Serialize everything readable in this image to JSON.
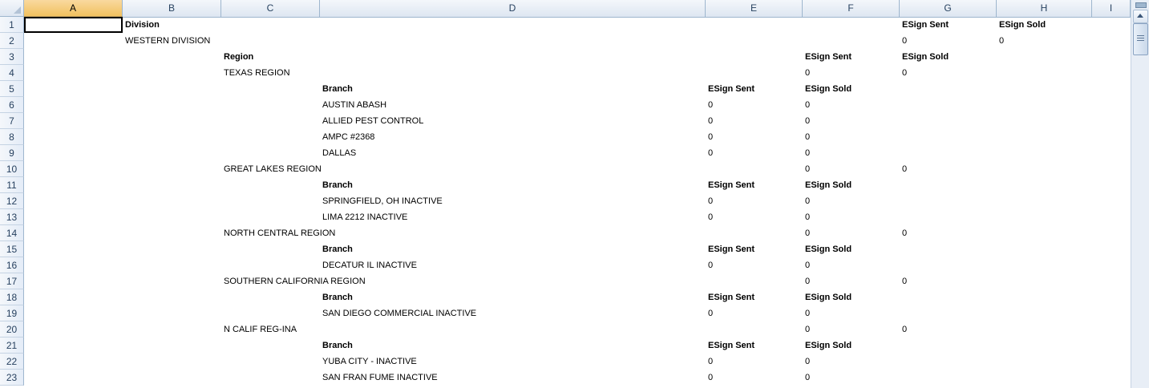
{
  "columns": [
    "A",
    "B",
    "C",
    "D",
    "E",
    "F",
    "G",
    "H",
    "I"
  ],
  "selected_column": "A",
  "rows": [
    {
      "n": "1",
      "cells": [
        {
          "col": "B",
          "text": "Division",
          "bold": true
        },
        {
          "col": "G",
          "text": "ESign Sent",
          "bold": true
        },
        {
          "col": "H",
          "text": "ESign Sold",
          "bold": true
        }
      ]
    },
    {
      "n": "2",
      "cells": [
        {
          "col": "B",
          "text": "WESTERN DIVISION"
        },
        {
          "col": "G",
          "text": "0"
        },
        {
          "col": "H",
          "text": "0"
        }
      ]
    },
    {
      "n": "3",
      "cells": [
        {
          "col": "C",
          "text": "Region",
          "bold": true
        },
        {
          "col": "F",
          "text": "ESign Sent",
          "bold": true
        },
        {
          "col": "G",
          "text": "ESign Sold",
          "bold": true
        }
      ]
    },
    {
      "n": "4",
      "cells": [
        {
          "col": "C",
          "text": "TEXAS REGION"
        },
        {
          "col": "F",
          "text": "0"
        },
        {
          "col": "G",
          "text": "0"
        }
      ]
    },
    {
      "n": "5",
      "cells": [
        {
          "col": "D",
          "text": "Branch",
          "bold": true
        },
        {
          "col": "E",
          "text": "ESign Sent",
          "bold": true
        },
        {
          "col": "F",
          "text": "ESign Sold",
          "bold": true
        }
      ]
    },
    {
      "n": "6",
      "cells": [
        {
          "col": "D",
          "text": "AUSTIN ABASH"
        },
        {
          "col": "E",
          "text": "0"
        },
        {
          "col": "F",
          "text": "0"
        }
      ]
    },
    {
      "n": "7",
      "cells": [
        {
          "col": "D",
          "text": "ALLIED PEST CONTROL"
        },
        {
          "col": "E",
          "text": "0"
        },
        {
          "col": "F",
          "text": "0"
        }
      ]
    },
    {
      "n": "8",
      "cells": [
        {
          "col": "D",
          "text": "AMPC #2368"
        },
        {
          "col": "E",
          "text": "0"
        },
        {
          "col": "F",
          "text": "0"
        }
      ]
    },
    {
      "n": "9",
      "cells": [
        {
          "col": "D",
          "text": "DALLAS"
        },
        {
          "col": "E",
          "text": "0"
        },
        {
          "col": "F",
          "text": "0"
        }
      ]
    },
    {
      "n": "10",
      "cells": [
        {
          "col": "C",
          "text": "GREAT LAKES REGION"
        },
        {
          "col": "F",
          "text": "0"
        },
        {
          "col": "G",
          "text": "0"
        }
      ]
    },
    {
      "n": "11",
      "cells": [
        {
          "col": "D",
          "text": "Branch",
          "bold": true
        },
        {
          "col": "E",
          "text": "ESign Sent",
          "bold": true
        },
        {
          "col": "F",
          "text": "ESign Sold",
          "bold": true
        }
      ]
    },
    {
      "n": "12",
      "cells": [
        {
          "col": "D",
          "text": "SPRINGFIELD, OH INACTIVE"
        },
        {
          "col": "E",
          "text": "0"
        },
        {
          "col": "F",
          "text": "0"
        }
      ]
    },
    {
      "n": "13",
      "cells": [
        {
          "col": "D",
          "text": "LIMA 2212 INACTIVE"
        },
        {
          "col": "E",
          "text": "0"
        },
        {
          "col": "F",
          "text": "0"
        }
      ]
    },
    {
      "n": "14",
      "cells": [
        {
          "col": "C",
          "text": "NORTH CENTRAL REGION"
        },
        {
          "col": "F",
          "text": "0"
        },
        {
          "col": "G",
          "text": "0"
        }
      ]
    },
    {
      "n": "15",
      "cells": [
        {
          "col": "D",
          "text": "Branch",
          "bold": true
        },
        {
          "col": "E",
          "text": "ESign Sent",
          "bold": true
        },
        {
          "col": "F",
          "text": "ESign Sold",
          "bold": true
        }
      ]
    },
    {
      "n": "16",
      "cells": [
        {
          "col": "D",
          "text": "DECATUR IL INACTIVE"
        },
        {
          "col": "E",
          "text": "0"
        },
        {
          "col": "F",
          "text": "0"
        }
      ]
    },
    {
      "n": "17",
      "cells": [
        {
          "col": "C",
          "text": "SOUTHERN CALIFORNIA REGION"
        },
        {
          "col": "F",
          "text": "0"
        },
        {
          "col": "G",
          "text": "0"
        }
      ]
    },
    {
      "n": "18",
      "cells": [
        {
          "col": "D",
          "text": "Branch",
          "bold": true
        },
        {
          "col": "E",
          "text": "ESign Sent",
          "bold": true
        },
        {
          "col": "F",
          "text": "ESign Sold",
          "bold": true
        }
      ]
    },
    {
      "n": "19",
      "cells": [
        {
          "col": "D",
          "text": "SAN DIEGO COMMERCIAL INACTIVE"
        },
        {
          "col": "E",
          "text": "0"
        },
        {
          "col": "F",
          "text": "0"
        }
      ]
    },
    {
      "n": "20",
      "cells": [
        {
          "col": "C",
          "text": "N CALIF REG-INA"
        },
        {
          "col": "F",
          "text": "0"
        },
        {
          "col": "G",
          "text": "0"
        }
      ]
    },
    {
      "n": "21",
      "cells": [
        {
          "col": "D",
          "text": "Branch",
          "bold": true
        },
        {
          "col": "E",
          "text": "ESign Sent",
          "bold": true
        },
        {
          "col": "F",
          "text": "ESign Sold",
          "bold": true
        }
      ]
    },
    {
      "n": "22",
      "cells": [
        {
          "col": "D",
          "text": "YUBA CITY - INACTIVE"
        },
        {
          "col": "E",
          "text": "0"
        },
        {
          "col": "F",
          "text": "0"
        }
      ]
    },
    {
      "n": "23",
      "cells": [
        {
          "col": "D",
          "text": "SAN FRAN FUME INACTIVE"
        },
        {
          "col": "E",
          "text": "0"
        },
        {
          "col": "F",
          "text": "0"
        }
      ]
    }
  ]
}
